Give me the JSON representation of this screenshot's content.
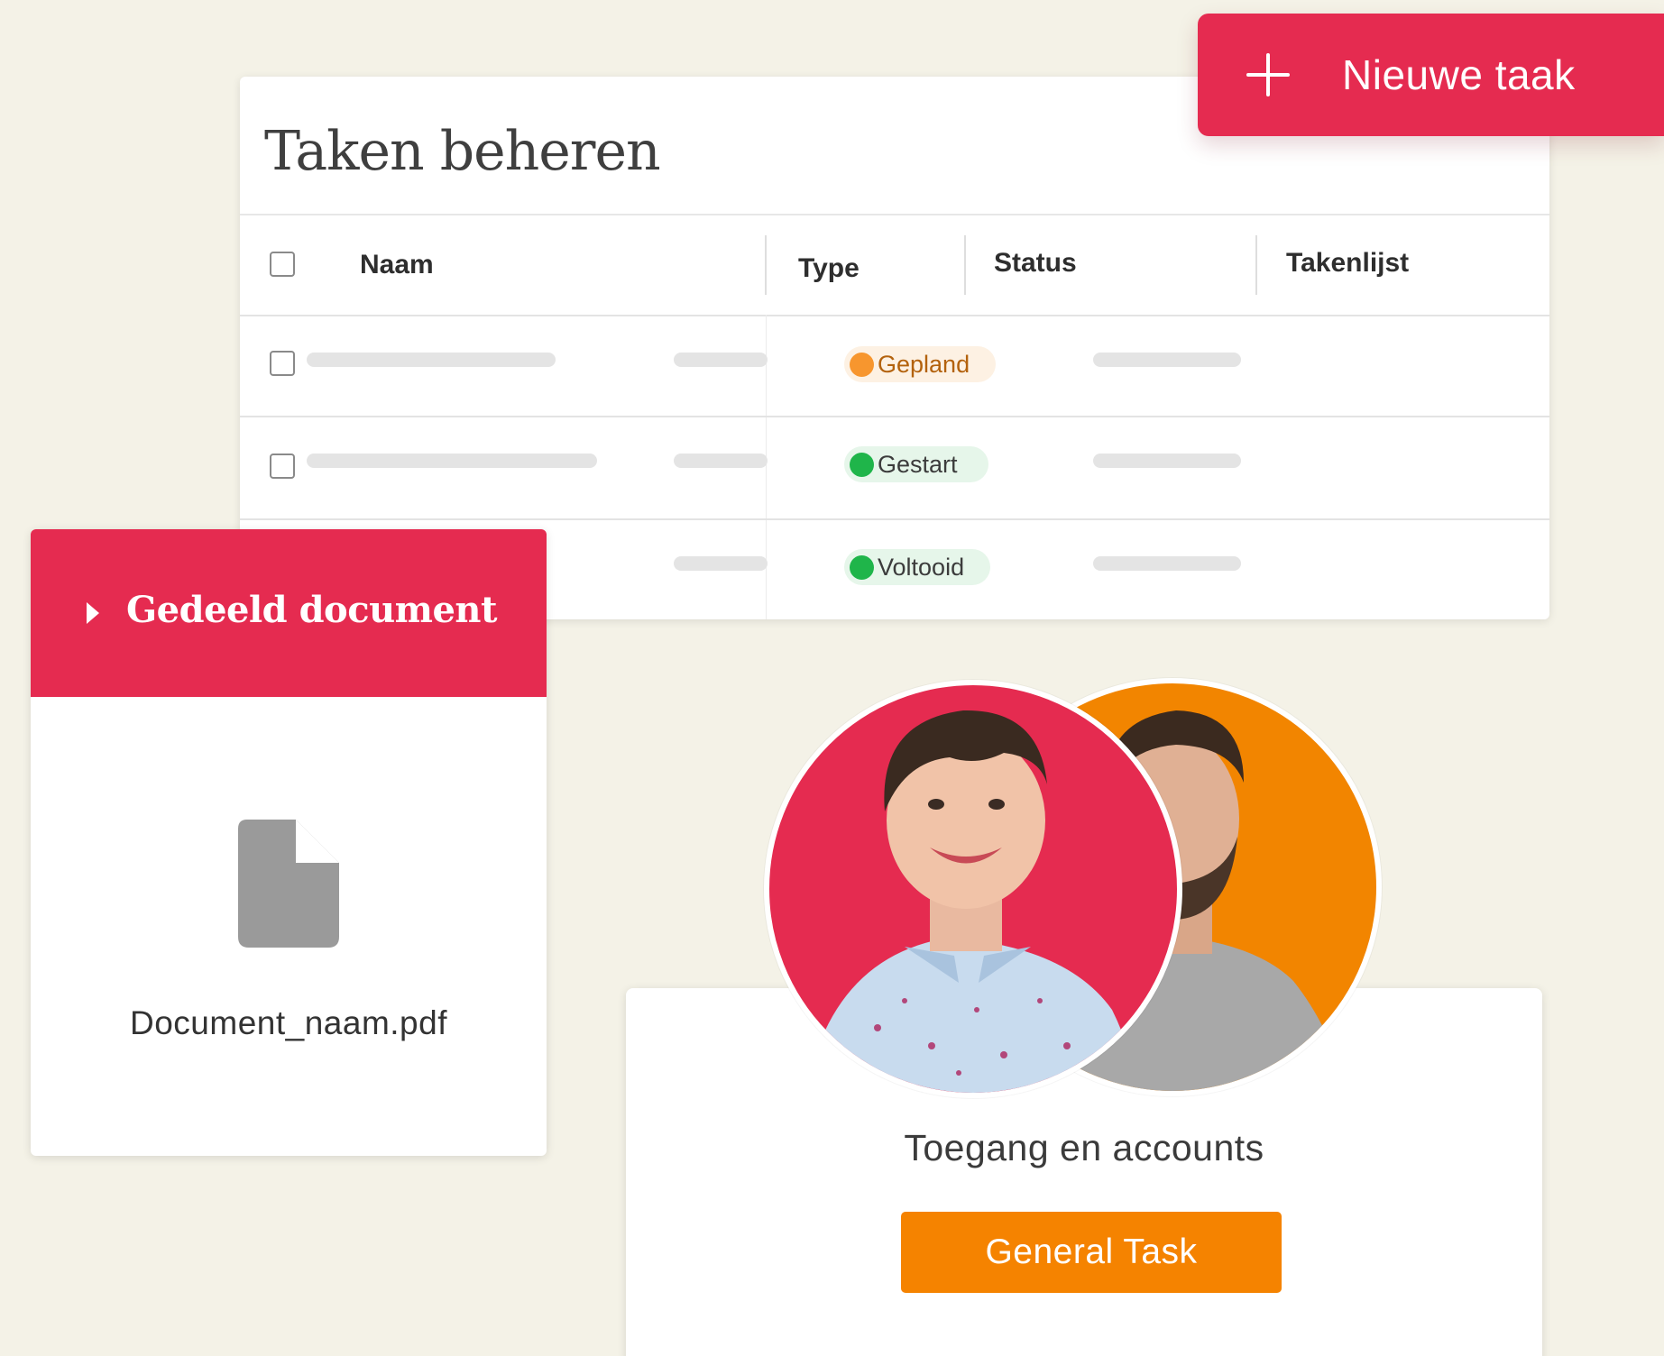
{
  "tasks_panel": {
    "title": "Taken beheren",
    "columns": [
      "Naam",
      "Type",
      "Status",
      "Takenlijst"
    ],
    "rows": [
      {
        "status": "Gepland"
      },
      {
        "status": "Gestart"
      },
      {
        "status": "Voltooid"
      }
    ]
  },
  "toolbar": {
    "new_task_label": "Nieuwe taak"
  },
  "document_card": {
    "title": "Gedeeld document",
    "file_name": "Document_naam.pdf",
    "icon": "file-icon"
  },
  "access_card": {
    "title": "Toegang en accounts",
    "button_label": "General Task"
  },
  "colors": {
    "accent_red": "#e52b50",
    "accent_orange": "#f58300",
    "status_planned": "#f7962e",
    "status_started": "#1fb54a",
    "status_done": "#1fb54a",
    "background": "#f4f2e7"
  }
}
